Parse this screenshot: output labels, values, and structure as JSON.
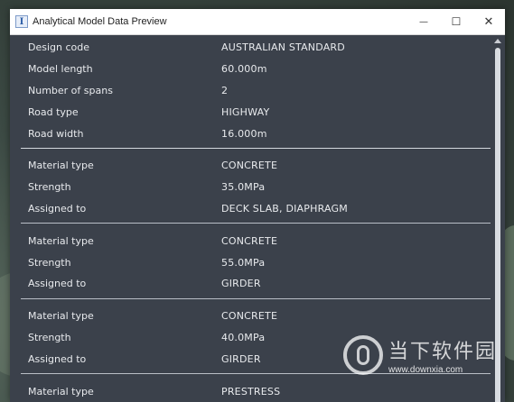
{
  "window": {
    "title": "Analytical Model Data Preview",
    "app_icon": "I",
    "minimize_glyph": "—",
    "maximize_glyph": "☐",
    "close_glyph": "✕"
  },
  "general": [
    {
      "label": "Design code",
      "value": "AUSTRALIAN STANDARD"
    },
    {
      "label": "Model length",
      "value": "60.000m"
    },
    {
      "label": "Number of spans",
      "value": "2"
    },
    {
      "label": "Road type",
      "value": "HIGHWAY"
    },
    {
      "label": "Road width",
      "value": "16.000m"
    }
  ],
  "materials": [
    [
      {
        "label": "Material type",
        "value": "CONCRETE"
      },
      {
        "label": "Strength",
        "value": "35.0MPa"
      },
      {
        "label": "Assigned to",
        "value": "DECK SLAB, DIAPHRAGM"
      }
    ],
    [
      {
        "label": "Material type",
        "value": "CONCRETE"
      },
      {
        "label": "Strength",
        "value": "55.0MPa"
      },
      {
        "label": "Assigned to",
        "value": "GIRDER"
      }
    ],
    [
      {
        "label": "Material type",
        "value": "CONCRETE"
      },
      {
        "label": "Strength",
        "value": "40.0MPa"
      },
      {
        "label": "Assigned to",
        "value": "GIRDER"
      }
    ],
    [
      {
        "label": "Material type",
        "value": "PRESTRESS"
      }
    ]
  ],
  "watermark": {
    "text": "当下软件园",
    "url": "www.downxia.com"
  }
}
